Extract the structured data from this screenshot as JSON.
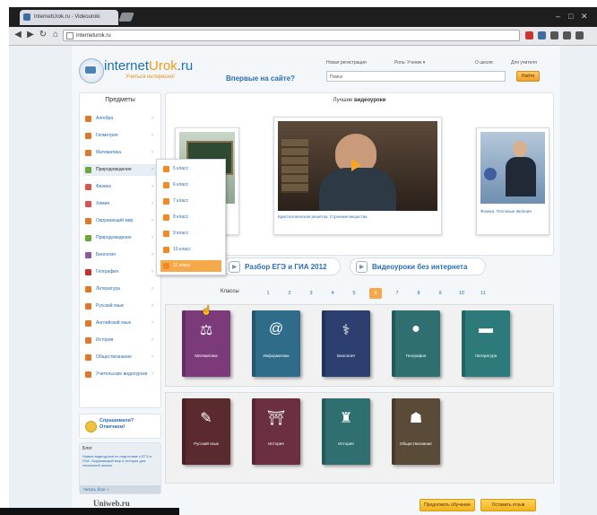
{
  "browser": {
    "tab_title": "InternetUrok.ru - Videouroki",
    "url": "interneturok.ru"
  },
  "header": {
    "logo_main": "internet",
    "logo_accent": "Urok",
    "logo_tld": ".ru",
    "logo_sub": "Учиться интересно!",
    "first_visit": "Впервые на сайте?",
    "login_link": "Новая регистрация",
    "role_label": "Роль: Ученик ▾",
    "about_link": "О школе",
    "help_link": "Для учителя",
    "search_placeholder": "Поиск",
    "search_button": "Найти"
  },
  "sidebar": {
    "title": "Предметы",
    "items": [
      {
        "label": "Алгебра",
        "color": "#e0782a"
      },
      {
        "label": "Геометрия",
        "color": "#e0782a"
      },
      {
        "label": "Математика",
        "color": "#e0782a"
      },
      {
        "label": "Природоведение",
        "color": "#6aa83a"
      },
      {
        "label": "Физика",
        "color": "#d9534f"
      },
      {
        "label": "Химия",
        "color": "#d9534f"
      },
      {
        "label": "Окружающий мир",
        "color": "#e0782a"
      },
      {
        "label": "Природоведение",
        "color": "#6aa83a"
      },
      {
        "label": "Биология",
        "color": "#8a5a9e"
      },
      {
        "label": "География",
        "color": "#c9302c"
      },
      {
        "label": "Литература",
        "color": "#e0782a"
      },
      {
        "label": "Русский язык",
        "color": "#e0782a"
      },
      {
        "label": "Английский язык",
        "color": "#e0782a"
      },
      {
        "label": "История",
        "color": "#e0782a"
      },
      {
        "label": "Обществознание",
        "color": "#e0782a"
      },
      {
        "label": "Учительские видеоуроки",
        "color": "#e0782a"
      }
    ],
    "flyout": [
      "5 класс",
      "6 класс",
      "7 класс",
      "8 класс",
      "9 класс",
      "10 класс",
      "11 класс"
    ],
    "ask_line1": "Спрашивали?",
    "ask_line2": "Отвечаем!",
    "blog_title": "Блог",
    "blog_text": "Новые видеоуроки по подготовке к ЕГЭ и ГИА. Окружающий мир и история для начальной школы.",
    "blog_more": "Читать блог »",
    "bottom_logo": "Uniweb.ru"
  },
  "best": {
    "title_prefix": "Лучшие",
    "title_bold": "видеоуроки",
    "cards": [
      {
        "caption": "Окружающий мир"
      },
      {
        "caption": "Кристаллическая решётка. Строение вещества"
      },
      {
        "caption": "Физика. Тепловые явления"
      }
    ]
  },
  "promos": {
    "exam": "Разбор ЕГЭ и ГИА 2012",
    "offline": "Видеоуроки без интернета"
  },
  "classes": {
    "label": "Классы",
    "items": [
      "1",
      "2",
      "3",
      "4",
      "5",
      "6",
      "7",
      "8",
      "9",
      "10",
      "11"
    ],
    "active": "6"
  },
  "books_row1": [
    {
      "title": "Математика",
      "color": "#7b3b7a",
      "icon": "ruler-icon",
      "glyph": "⚖"
    },
    {
      "title": "Информатика",
      "color": "#2f6c8a",
      "icon": "at-icon",
      "glyph": "@"
    },
    {
      "title": "Биология",
      "color": "#2c3f6e",
      "icon": "dna-icon",
      "glyph": "⚕"
    },
    {
      "title": "География",
      "color": "#2f6f70",
      "icon": "globe-icon",
      "glyph": "●"
    },
    {
      "title": "Литература",
      "color": "#2d7a7a",
      "icon": "book-icon",
      "glyph": "▬"
    }
  ],
  "books_row2": [
    {
      "title": "Русский язык",
      "color": "#5a2a2e",
      "icon": "quill-icon",
      "glyph": "✎"
    },
    {
      "title": "История",
      "color": "#6b3040",
      "icon": "bridge-icon",
      "glyph": "⛩"
    },
    {
      "title": "История",
      "color": "#2f6f70",
      "icon": "shirt-icon",
      "glyph": "♜"
    },
    {
      "title": "Обществознание",
      "color": "#5a4a38",
      "icon": "crowd-icon",
      "glyph": "☗"
    }
  ],
  "footer": {
    "btn1": "Продолжить обучение",
    "btn2": "Оставить отзыв"
  }
}
